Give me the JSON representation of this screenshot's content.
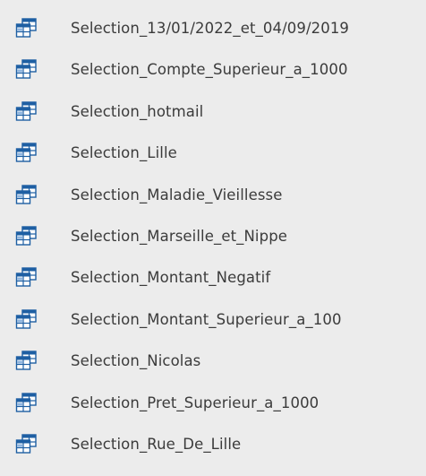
{
  "navigation_pane": {
    "object_type_icon": "query-datasheet-icon",
    "items": [
      {
        "label": "Selection_13/01/2022_et_04/09/2019"
      },
      {
        "label": "Selection_Compte_Superieur_a_1000"
      },
      {
        "label": "Selection_hotmail"
      },
      {
        "label": "Selection_Lille"
      },
      {
        "label": "Selection_Maladie_Vieillesse"
      },
      {
        "label": "Selection_Marseille_et_Nippe"
      },
      {
        "label": "Selection_Montant_Negatif"
      },
      {
        "label": "Selection_Montant_Superieur_a_100"
      },
      {
        "label": "Selection_Nicolas"
      },
      {
        "label": "Selection_Pret_Superieur_a_1000"
      },
      {
        "label": "Selection_Rue_De_Lille"
      }
    ]
  },
  "colors": {
    "background": "#ececec",
    "text": "#3b3b3b",
    "icon_blue": "#1e5fa3",
    "icon_light": "#8fb6e0"
  }
}
